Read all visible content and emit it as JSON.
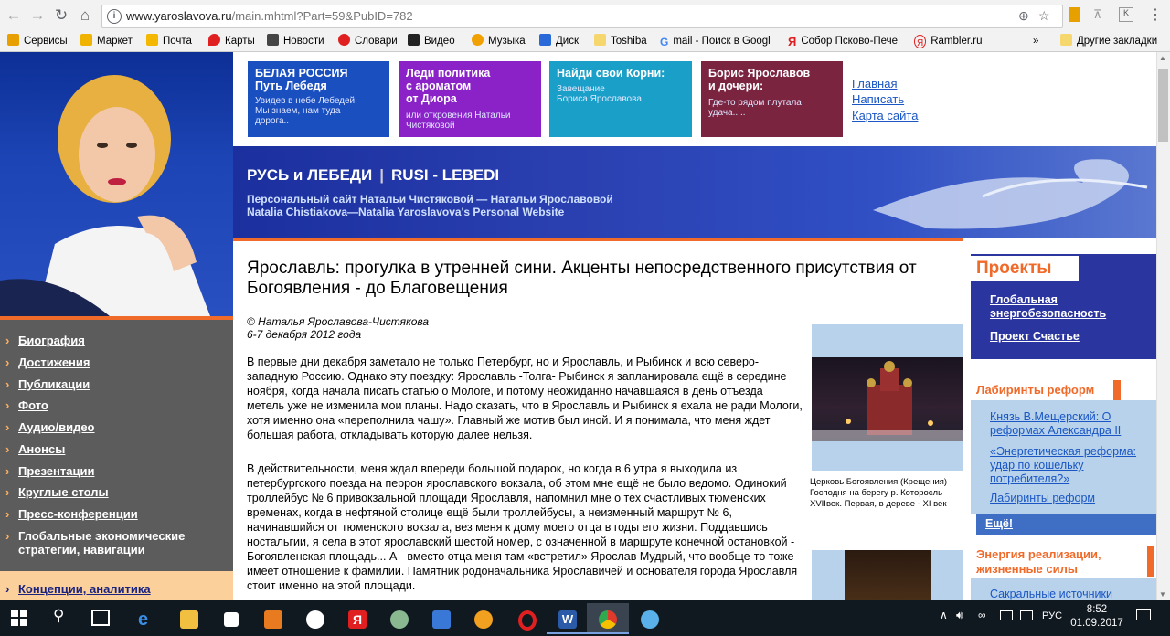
{
  "browser": {
    "url_host": "www.yaroslavova.ru",
    "url_path": "/main.mhtml?Part=59&PubID=782",
    "bookmarks": [
      {
        "label": "Сервисы",
        "color": "#e8a000"
      },
      {
        "label": "Маркет",
        "color": "#f0b400"
      },
      {
        "label": "Почта",
        "color": "#f5b800"
      },
      {
        "label": "Карты",
        "color": "#e02020"
      },
      {
        "label": "Новости",
        "color": "#444444"
      },
      {
        "label": "Словари",
        "color": "#e02020"
      },
      {
        "label": "Видео",
        "color": "#222222"
      },
      {
        "label": "Музыка",
        "color": "#f0a000"
      },
      {
        "label": "Диск",
        "color": "#2a6ad8"
      },
      {
        "label": "Toshiba",
        "color": "#f5d76e"
      },
      {
        "label": "mail - Поиск в Googl",
        "color": "#ffffff"
      },
      {
        "label": "Собор Псково-Пече",
        "color": "#ffffff"
      },
      {
        "label": "Rambler.ru",
        "color": "#ffffff"
      }
    ],
    "overflow": "»",
    "other_bookmarks": "Другие закладки"
  },
  "header": {
    "banners": [
      {
        "title": "БЕЛАЯ РОССИЯ\nПуть Лебедя",
        "sub": "Увидев в небе Лебедей,\nМы знаем, нам туда\nдорога..",
        "color": "#1a4fc0"
      },
      {
        "title": "Леди политика\nс ароматом\nот Диора",
        "sub": "или откровения Натальи\nЧистяковой",
        "color": "#8a22c8"
      },
      {
        "title": "Найди свои Корни:",
        "sub": "Завещание\nБориса Ярославова",
        "color": "#1aa0c8"
      },
      {
        "title": "Борис Ярославов\nи дочери:",
        "sub": "Где-то рядом плутала\nудача.....",
        "color": "#7a2440"
      }
    ],
    "links": [
      "Главная",
      "Написать",
      "Карта сайта"
    ],
    "site_title": "РУСЬ и ЛЕБЕДИ",
    "site_title_en": "RUSI - LEBEDI",
    "subtitle_ru": "Персональный сайт Натальи Чистяковой — Натальи Ярославовой",
    "subtitle_en": "Natalia Chistiakova—Natalia Yaroslavova's Personal Website"
  },
  "sidebar": {
    "items": [
      "Биография",
      "Достижения",
      "Публикации",
      "Фото",
      "Аудио/видео",
      "Анонсы",
      "Презентации",
      "Круглые столы",
      "Пресс-конференции",
      "Глобальные экономические\nстратегии, навигации"
    ],
    "concepts": "Концепции, аналитика"
  },
  "article": {
    "title": "Ярославль: прогулка в утренней сини. Акценты непосредственного присутствия от Богоявления - до Благовещения",
    "author": "© Наталья Ярославова-Чистякова",
    "date": "6-7 декабря 2012 года",
    "paragraphs": [
      "В первые дни декабря заметало не только Петербург, но и Ярославль, и Рыбинск и всю северо-западную Россию. Однако эту поездку: Ярославль -Толга- Рыбинск я запланировала ещё в середине ноября, когда начала писать статью о Мологе, и потому неожиданно начавшаяся в день отъезда метель уже не изменила мои планы. Надо сказать, что в Ярославль и Рыбинск я ехала не ради Мологи, хотя именно она «переполнила чашу». Главный же мотив был иной. И я понимала, что меня ждет большая работа, откладывать которую далее нельзя.",
      "В действительности, меня ждал впереди большой подарок, но когда в 6 утра я выходила из петербургского поезда на перрон ярославского вокзала, об этом мне ещё не было ведомо. Одинокий троллейбус № 6 привокзальной площади Ярославля, напомнил мне о тех счастливых тюменских временах, когда в нефтяной столице ещё были троллейбусы, а неизменный маршрут № 6, начинавшийся от тюменского вокзала, вез меня к дому моего отца в годы его жизни. Поддавшись ностальгии, я села в этот ярославский шестой номер, с означенной в маршруте конечной остановкой - Богоявленская площадь... А - вместо отца меня там «встретил» Ярослав Мудрый, что вообще-то тоже имеет отношение к фамилии. Памятник родоначальника Ярославичей и основателя города Ярославля стоит именно на этой площади."
    ],
    "photo_caption": "Церковь Богоявления (Крещения) Господня на берегу р. Которосль XVIIвек. Первая, в деревe - XI век"
  },
  "right": {
    "projects_title": "Проекты",
    "projects": [
      "Глобальная\nэнергобезопасность",
      "Проект Счастье"
    ],
    "labyrinth_title": "Лабиринты реформ",
    "labyrinth_links": [
      "Князь В.Мещерский: О реформах Александра II",
      "«Энергетическая реформа: удар по кошельку потребителя?»",
      "Лабиринты реформ"
    ],
    "more": "Ещё!",
    "energy_title": "Энергия реализации, жизненные силы",
    "energy_links": [
      "Сакральные источники"
    ]
  },
  "taskbar": {
    "time": "8:52",
    "date": "01.09.2017",
    "lang": "РУС"
  }
}
